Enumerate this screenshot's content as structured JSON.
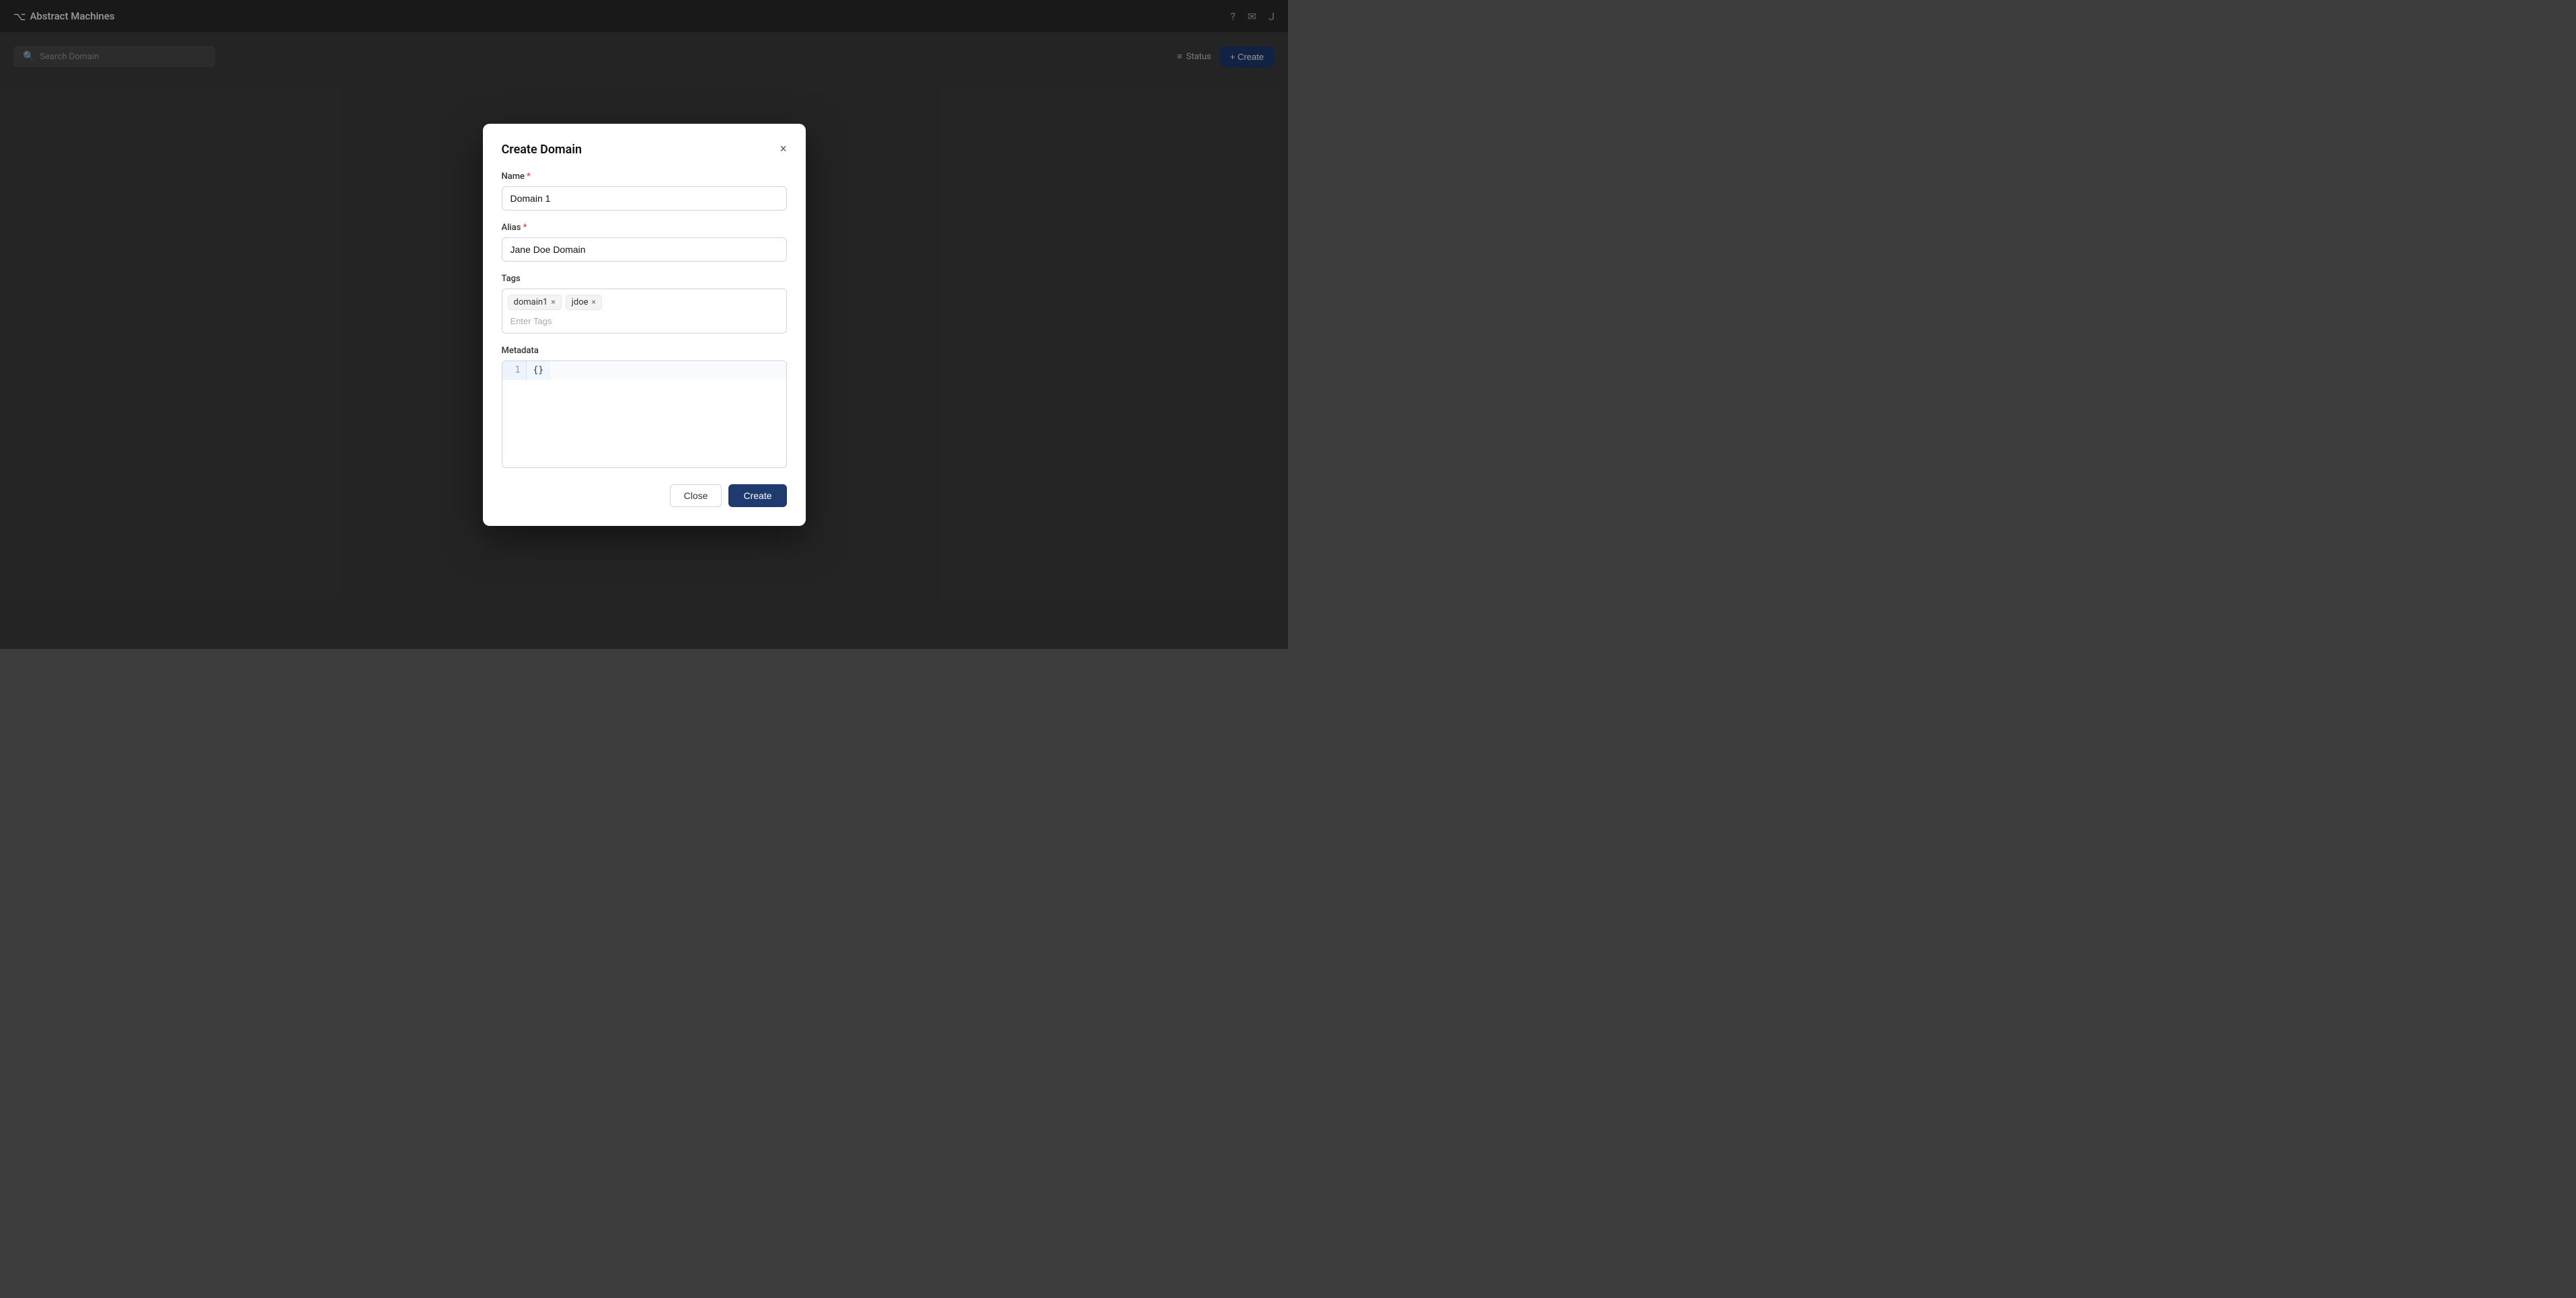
{
  "app": {
    "name": "Abstract Machines"
  },
  "topbar": {
    "logo_text": "Abstract Machines",
    "icons": [
      "help-icon",
      "mail-icon",
      "user-icon"
    ]
  },
  "search": {
    "placeholder": "Search Domain"
  },
  "page_actions": {
    "status_label": "Status",
    "create_label": "+ Create"
  },
  "modal": {
    "title": "Create Domain",
    "close_label": "×",
    "name_label": "Name",
    "name_required": "*",
    "name_value": "Domain 1",
    "alias_label": "Alias",
    "alias_required": "*",
    "alias_value": "Jane Doe Domain",
    "tags_label": "Tags",
    "tags": [
      {
        "label": "domain1"
      },
      {
        "label": "jdoe"
      }
    ],
    "tags_input_placeholder": "Enter Tags",
    "metadata_label": "Metadata",
    "metadata_line_number": "1",
    "metadata_line_content": "{}",
    "close_button": "Close",
    "create_button": "Create"
  }
}
